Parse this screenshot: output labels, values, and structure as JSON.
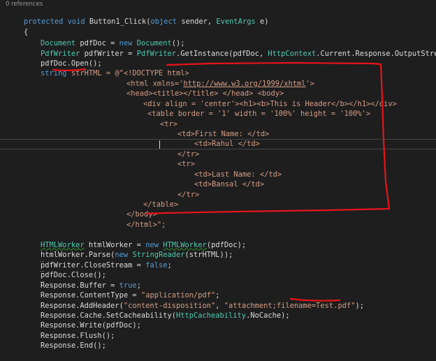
{
  "codelens": "0 references",
  "code": {
    "l1": [
      "protected",
      "void",
      "Button1_Click(",
      "object",
      "sender,",
      "EventArgs",
      "e)"
    ],
    "l2": "{",
    "l3": [
      "Document",
      "pdfDoc =",
      "new",
      "Document",
      "();"
    ],
    "l4": [
      "PdfWriter",
      "pdfWriter =",
      "PdfWriter",
      ".GetInstance(pdfDoc,",
      "HttpContext",
      ".Current.Response.OutputStream);"
    ],
    "l5": "pdfDoc.Open();",
    "l6": [
      "string",
      "strHTML = @\"<!DOCTYPE html>"
    ],
    "l7": [
      "<html xmlns='",
      "http://www.w3.org/1999/xhtml",
      "'>"
    ],
    "l8": "<head><title></title> </head> <body>",
    "l9": "<div align = 'center'><h1><b>This is Header</b></h1></div>",
    "l10": "<table border = '1' width = '100%' height = '100%'>",
    "l11": "<tr>",
    "l12": "<td>First Name: </td>",
    "l13": "<td>Rahul </td>",
    "l14": "</tr>",
    "l15": "<tr>",
    "l16": "<td>Last Name: </td>",
    "l17": "<td>Bansal </td>",
    "l18": "</tr>",
    "l19": "</table>",
    "l20": "</body>",
    "l21": "</html>\";",
    "l22": [
      "HTMLWorker",
      "htmlWorker =",
      "new",
      "HTMLWorker",
      "(pdfDoc);"
    ],
    "l23": [
      "htmlWorker.Parse(",
      "new",
      "StringReader",
      "(strHTML));"
    ],
    "l24": [
      "pdfWriter.CloseStream =",
      "false",
      ";"
    ],
    "l25": "pdfDoc.Close();",
    "l26": [
      "Response.Buffer =",
      "true",
      ";"
    ],
    "l27": [
      "Response.ContentType =",
      "\"application/pdf\"",
      ";"
    ],
    "l28": [
      "Response.AddHeader(",
      "\"content-disposition\"",
      ",",
      "\"attachment;filename=Test.pdf\"",
      ");"
    ],
    "l29": [
      "Response.Cache.SetCacheability(",
      "HttpCacheability",
      ".NoCache);"
    ],
    "l30": "Response.Write(pdfDoc);",
    "l31": "Response.Flush();",
    "l32": "Response.End();"
  },
  "colors": {
    "background": "#1e1e1e",
    "keyword": "#569cd6",
    "type": "#4ec9b0",
    "string": "#d69d85",
    "text": "#dcdcdc",
    "annotation": "#e8141a"
  }
}
